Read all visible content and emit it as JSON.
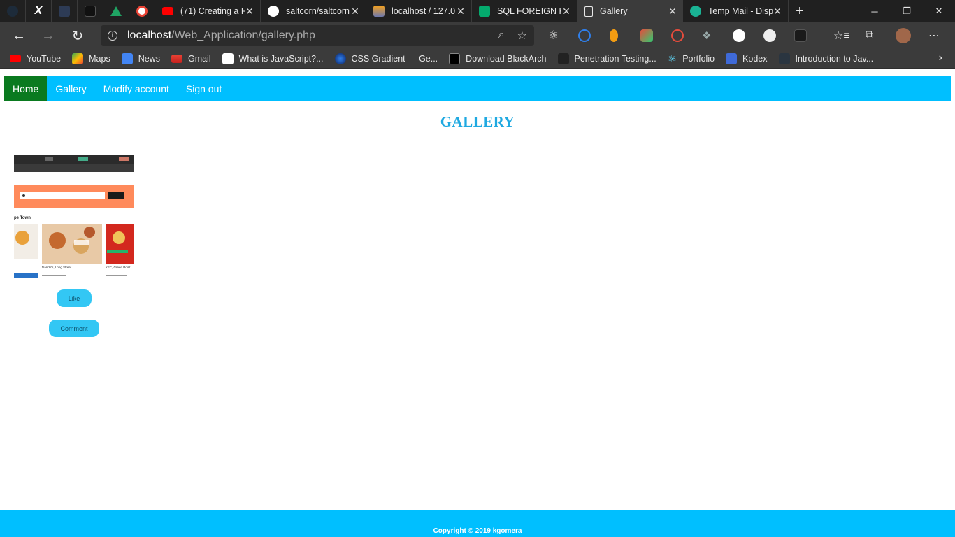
{
  "browser": {
    "tabs": [
      {
        "title": "(71) Creating a R",
        "icon": "youtube-icon"
      },
      {
        "title": "saltcorn/saltcorn",
        "icon": "github-icon"
      },
      {
        "title": "localhost / 127.0",
        "icon": "phpmyadmin-icon"
      },
      {
        "title": "SQL FOREIGN KE",
        "icon": "w3schools-icon"
      },
      {
        "title": "Gallery",
        "icon": "page-icon",
        "active": true
      },
      {
        "title": "Temp Mail - Disp",
        "icon": "tempmail-icon"
      }
    ],
    "address": {
      "host": "localhost",
      "path": "/Web_Application/gallery.php"
    },
    "bookmarks": [
      {
        "label": "YouTube"
      },
      {
        "label": "Maps"
      },
      {
        "label": "News"
      },
      {
        "label": "Gmail"
      },
      {
        "label": "What is JavaScript?..."
      },
      {
        "label": "CSS Gradient — Ge..."
      },
      {
        "label": "Download BlackArch"
      },
      {
        "label": "Penetration Testing..."
      },
      {
        "label": "Portfolio"
      },
      {
        "label": "Kodex"
      },
      {
        "label": "Introduction to Jav..."
      }
    ]
  },
  "nav": {
    "home": "Home",
    "gallery": "Gallery",
    "modify": "Modify account",
    "signout": "Sign out"
  },
  "page": {
    "title": "GALLERY",
    "like": "Like",
    "comment": "Comment",
    "photo_caption": "pe Town",
    "food_items": [
      {
        "name": "Nando's, Long Street"
      },
      {
        "name": "KFC, Green Point"
      }
    ]
  },
  "footer": {
    "copyright": "Copyright © 2019 kgomera"
  },
  "colors": {
    "nav_bg": "#00bfff",
    "nav_active": "#0a7a1f",
    "title": "#1fa9e1",
    "button": "#33c7f4"
  }
}
